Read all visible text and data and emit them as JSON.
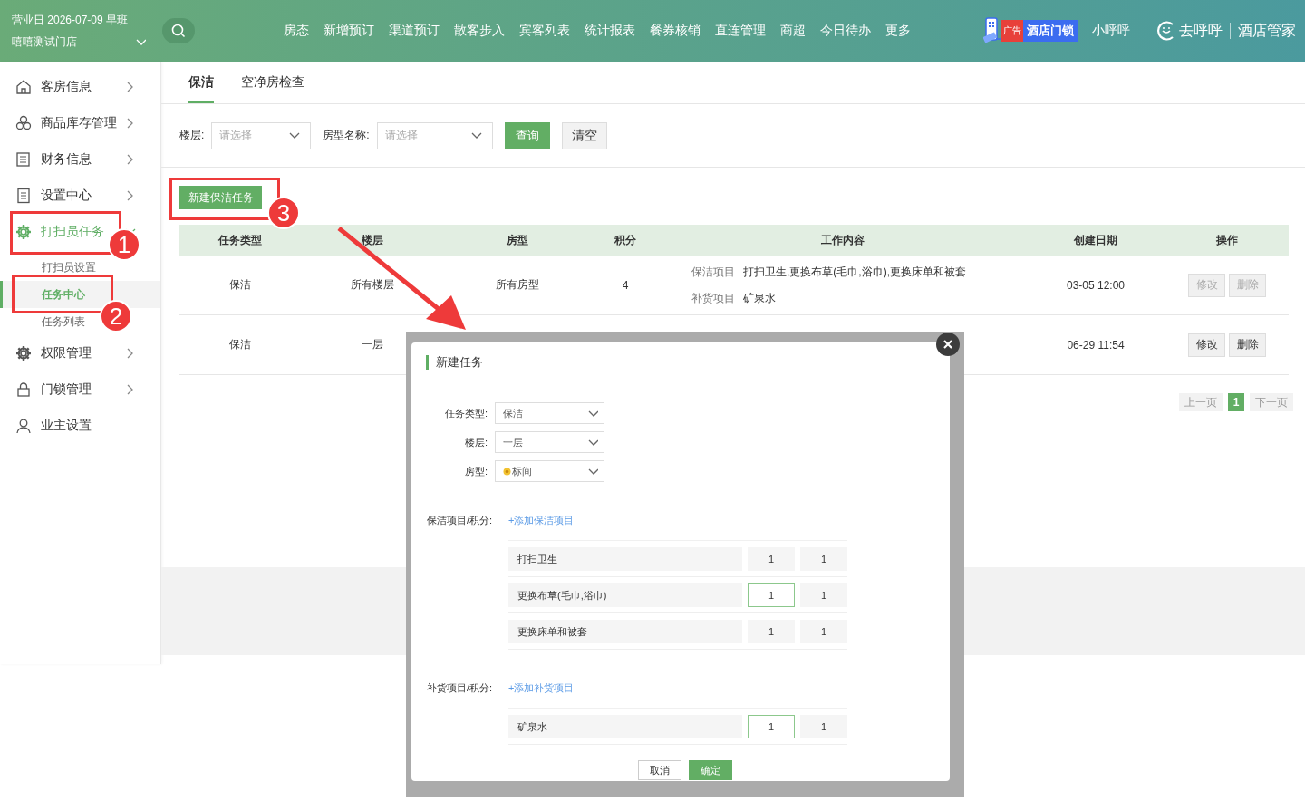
{
  "header": {
    "business_day": "营业日 2026-07-09 早班",
    "store": "嘻嘻测试门店",
    "nav": [
      "房态",
      "新增预订",
      "渠道预订",
      "散客步入",
      "宾客列表",
      "统计报表",
      "餐券核销",
      "直连管理",
      "商超",
      "今日待办",
      "更多"
    ],
    "ad": {
      "badge": "广告",
      "label": "酒店门锁"
    },
    "user": "小呼呼",
    "brand": "去呼呼",
    "product": "酒店管家"
  },
  "sidebar": {
    "items": [
      {
        "label": "客房信息",
        "selected": false,
        "expanded": false
      },
      {
        "label": "商品库存管理",
        "selected": false,
        "expanded": false
      },
      {
        "label": "财务信息",
        "selected": false,
        "expanded": false
      },
      {
        "label": "设置中心",
        "selected": false,
        "expanded": false
      },
      {
        "label": "打扫员任务",
        "selected": true,
        "expanded": true,
        "children": [
          {
            "label": "打扫员设置",
            "selected": false
          },
          {
            "label": "任务中心",
            "selected": true
          },
          {
            "label": "任务列表",
            "selected": false
          }
        ]
      },
      {
        "label": "权限管理",
        "selected": false,
        "expanded": false
      },
      {
        "label": "门锁管理",
        "selected": false,
        "expanded": false
      },
      {
        "label": "业主设置",
        "selected": false
      }
    ]
  },
  "tabs": [
    {
      "label": "保洁",
      "selected": true
    },
    {
      "label": "空净房检查",
      "selected": false
    }
  ],
  "filters": [
    {
      "label": "楼层:",
      "placeholder": "请选择"
    },
    {
      "label": "房型名称:",
      "placeholder": "请选择"
    }
  ],
  "query_button": "查询",
  "clear_button": "清空",
  "new_button": "新建保洁任务",
  "table": {
    "columns": [
      "任务类型",
      "楼层",
      "房型",
      "积分",
      "工作内容",
      "创建日期",
      "操作"
    ],
    "rows": [
      {
        "task_type": "保洁",
        "floor": "所有楼层",
        "room_type": "所有房型",
        "points": "4",
        "work_content": [
          {
            "label": "保洁项目",
            "value": "打扫卫生,更换布草(毛巾,浴巾),更换床单和被套"
          },
          {
            "label": "补货项目",
            "value": "矿泉水"
          }
        ],
        "created": "03-05 12:00",
        "actions": [
          {
            "label": "修改",
            "disabled": true
          },
          {
            "label": "删除",
            "disabled": true
          }
        ]
      },
      {
        "task_type": "保洁",
        "floor": "一层",
        "created": "06-29 11:54",
        "actions": [
          {
            "label": "修改",
            "disabled": false
          },
          {
            "label": "删除",
            "disabled": false
          }
        ]
      }
    ]
  },
  "pagination": {
    "prev": {
      "label": "上一页",
      "disabled": true
    },
    "pages": [
      {
        "label": "1",
        "selected": true
      }
    ],
    "next": {
      "label": "下一页",
      "disabled": true
    }
  },
  "dialog": {
    "title": "新建任务",
    "fields": [
      {
        "label": "任务类型:",
        "value": "保洁"
      },
      {
        "label": "楼层:",
        "value": "一层"
      },
      {
        "label": "房型:",
        "value": "标间",
        "kind": "icon"
      }
    ],
    "sections": [
      {
        "label": "保洁项目/积分:",
        "add_link": "+添加保洁项目",
        "items": [
          {
            "name": "打扫卫生",
            "value1": "1",
            "value2": "1",
            "focused": false
          },
          {
            "name": "更换布草(毛巾,浴巾)",
            "value1": "1",
            "value2": "1",
            "focused": true
          },
          {
            "name": "更换床单和被套",
            "value1": "1",
            "value2": "1",
            "focused": false
          }
        ]
      },
      {
        "label": "补货项目/积分:",
        "add_link": "+添加补货项目",
        "items": [
          {
            "name": "矿泉水",
            "value1": "1",
            "value2": "1",
            "focused": true
          }
        ]
      }
    ],
    "cancel": "取消",
    "confirm": "确定"
  },
  "annotations": [
    "1",
    "2",
    "3"
  ]
}
